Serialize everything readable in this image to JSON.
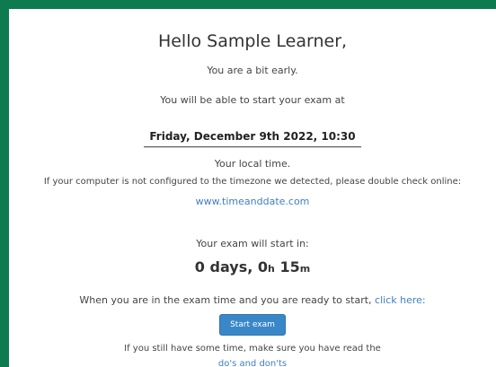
{
  "colors": {
    "background": "#0d7a4f",
    "card": "#ffffff",
    "link": "#3f7fc4",
    "button": "#3a87c8"
  },
  "greeting": "Hello Sample Learner,",
  "early_message": "You are a bit early.",
  "start_info": "You will be able to start your exam at",
  "exam_datetime": "Friday, December 9th 2022, 10:30",
  "local_time_note": "Your local time.",
  "timezone_note": "If your computer is not configured to the timezone we detected, please double check online:",
  "timezone_link": "www.timeanddate.com",
  "countdown": {
    "label": "Your exam will start in:",
    "days_value": "0",
    "days_label": "days,",
    "hours_value": "0",
    "hours_unit": "h",
    "minutes_value": "15",
    "minutes_unit": "m"
  },
  "ready": {
    "text": "When you are in the exam time and you are ready to start,",
    "link": "click here:"
  },
  "start_button": "Start exam",
  "reminder": {
    "text": "If you still have some time, make sure you have read the",
    "link": "do's and don'ts"
  }
}
